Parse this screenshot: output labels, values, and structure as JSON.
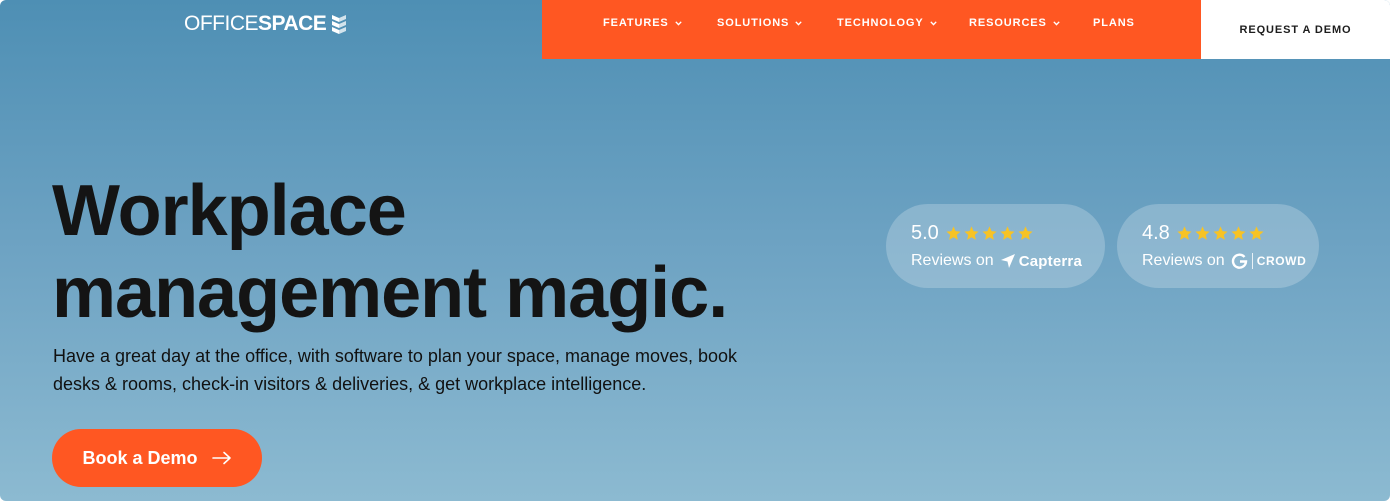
{
  "header": {
    "logo": {
      "light": "OFFICE",
      "bold": "SPACE",
      "icon": "officespace-logo-mark-icon"
    },
    "nav": [
      {
        "label": "FEATURES",
        "has_dropdown": true
      },
      {
        "label": "SOLUTIONS",
        "has_dropdown": true
      },
      {
        "label": "TECHNOLOGY",
        "has_dropdown": true
      },
      {
        "label": "RESOURCES",
        "has_dropdown": true
      },
      {
        "label": "PLANS",
        "has_dropdown": false
      }
    ],
    "request_demo": "REQUEST A DEMO"
  },
  "hero": {
    "headline_line1": "Workplace",
    "headline_line2": "management magic.",
    "subtitle_line1": "Have a great day at the office, with software to plan your space, manage moves, book",
    "subtitle_line2": "desks & rooms, check-in visitors & deliveries, & get workplace intelligence.",
    "cta": "Book a Demo",
    "cta_icon": "arrow-right-icon"
  },
  "ratings": [
    {
      "score": "5.0",
      "stars": 5,
      "prefix": "Reviews on",
      "brand": "Capterra",
      "brand_icon": "capterra-logo-icon"
    },
    {
      "score": "4.8",
      "stars": 5,
      "prefix": "Reviews on",
      "brand": "CROWD",
      "brand_icon": "g2-logo-icon"
    }
  ],
  "colors": {
    "accent": "#ff5722",
    "star": "#f7c325",
    "hero_top": "#4e8fb4",
    "hero_bottom": "#8cbad1",
    "text_dark": "#141414"
  }
}
